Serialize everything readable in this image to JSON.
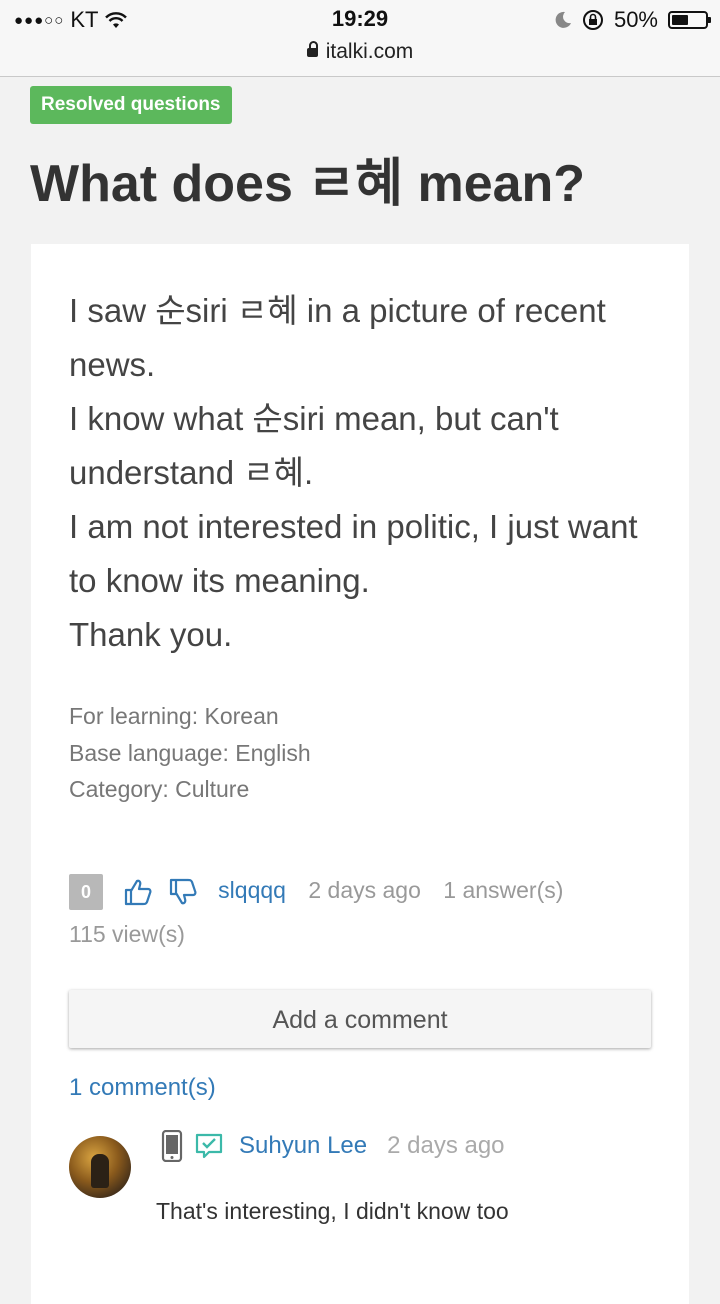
{
  "status_bar": {
    "carrier": "KT",
    "signal": "●●●○○",
    "time": "19:29",
    "battery": "50%",
    "battery_level": 0.5
  },
  "browser": {
    "url": "italki.com"
  },
  "question": {
    "tag": "Resolved questions",
    "title": "What does ㄹ혜 mean?",
    "body": "I saw 순siri ㄹ혜 in a picture of recent news.\nI know what 순siri mean, but can't understand ㄹ혜.\nI am not interested in politic, I just want to know its meaning.\nThank you.",
    "meta": {
      "learning": "For learning: Korean",
      "base": "Base language: English",
      "category": "Category: Culture"
    },
    "stats": {
      "score": "0",
      "author": "slqqqq",
      "posted": "2 days ago",
      "answers": "1 answer(s)",
      "views": "115 view(s)"
    },
    "add_comment_label": "Add a comment",
    "comment_count": "1 comment(s)"
  },
  "comment": {
    "author": "Suhyun Lee",
    "time": "2 days ago",
    "text": "That's interesting, I didn't know too"
  },
  "colors": {
    "tag": "#5cb85c",
    "link": "#337ab7",
    "muted": "#999999"
  }
}
